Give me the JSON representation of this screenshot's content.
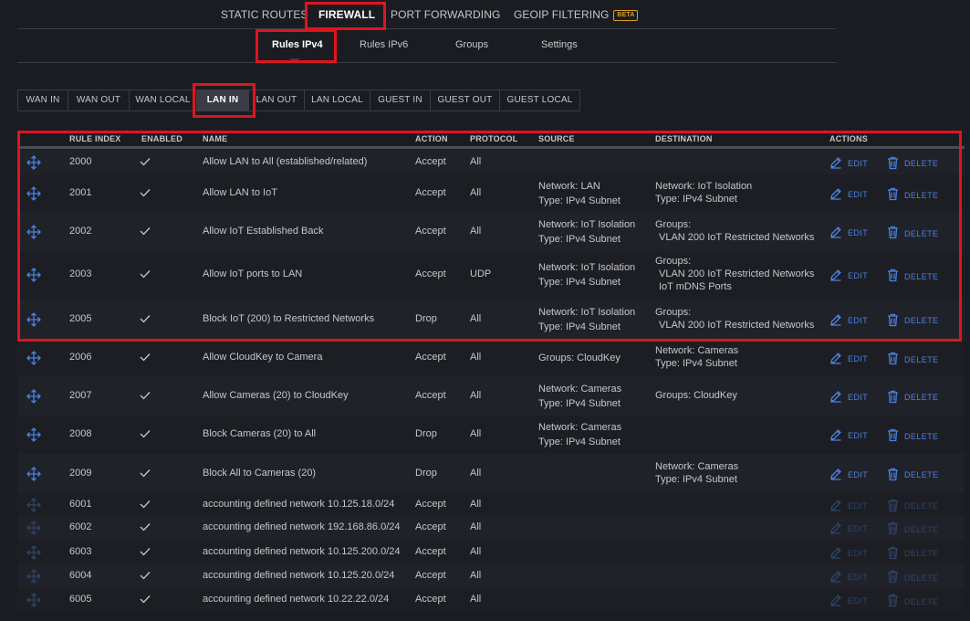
{
  "top_tabs": {
    "static_routes": "STATIC ROUTES",
    "firewall": "FIREWALL",
    "port_forwarding": "PORT FORWARDING",
    "geoip": "GEOIP FILTERING",
    "beta": "BETA"
  },
  "sub_tabs": {
    "rules_ipv4": "Rules IPv4",
    "rules_ipv6": "Rules IPv6",
    "groups": "Groups",
    "settings": "Settings"
  },
  "rule_sets": [
    "WAN IN",
    "WAN OUT",
    "WAN LOCAL",
    "LAN IN",
    "LAN OUT",
    "LAN LOCAL",
    "GUEST IN",
    "GUEST OUT",
    "GUEST LOCAL"
  ],
  "selected_rule_set": "LAN IN",
  "table": {
    "headers": {
      "index": "RULE INDEX",
      "enabled": "ENABLED",
      "name": "NAME",
      "action": "ACTION",
      "protocol": "PROTOCOL",
      "source": "SOURCE",
      "destination": "DESTINATION",
      "actions": "ACTIONS"
    },
    "edit_label": "EDIT",
    "delete_label": "DELETE",
    "rows": [
      {
        "index": "2000",
        "name": "Allow LAN to All (established/related)",
        "action": "Accept",
        "protocol": "All",
        "src1": "",
        "src2": "",
        "dst1": "",
        "dst2": "",
        "dst3": ""
      },
      {
        "index": "2001",
        "name": "Allow LAN to IoT",
        "action": "Accept",
        "protocol": "All",
        "src1": "Network: LAN",
        "src2": "Type: IPv4 Subnet",
        "dst1": "Network: IoT Isolation",
        "dst2": "Type: IPv4 Subnet",
        "dst3": ""
      },
      {
        "index": "2002",
        "name": "Allow IoT Established Back",
        "action": "Accept",
        "protocol": "All",
        "src1": "Network: IoT Isolation",
        "src2": "Type: IPv4 Subnet",
        "dst1": "Groups:",
        "dst2": "VLAN 200 IoT Restricted Networks",
        "dst3": ""
      },
      {
        "index": "2003",
        "name": "Allow IoT ports to LAN",
        "action": "Accept",
        "protocol": "UDP",
        "src1": "Network: IoT Isolation",
        "src2": "Type: IPv4 Subnet",
        "dst1": "Groups:",
        "dst2": "VLAN 200 IoT Restricted Networks",
        "dst3": "IoT mDNS Ports"
      },
      {
        "index": "2005",
        "name": "Block IoT (200) to Restricted Networks",
        "action": "Drop",
        "protocol": "All",
        "src1": "Network: IoT Isolation",
        "src2": "Type: IPv4 Subnet",
        "dst1": "Groups:",
        "dst2": "VLAN 200 IoT Restricted Networks",
        "dst3": ""
      },
      {
        "index": "2006",
        "name": "Allow CloudKey to Camera",
        "action": "Accept",
        "protocol": "All",
        "src1": "Groups:  CloudKey",
        "src2": "",
        "dst1": "Network: Cameras",
        "dst2": "Type: IPv4 Subnet",
        "dst3": ""
      },
      {
        "index": "2007",
        "name": "Allow Cameras (20) to CloudKey",
        "action": "Accept",
        "protocol": "All",
        "src1": "Network: Cameras",
        "src2": "Type: IPv4 Subnet",
        "dst1": "Groups:  CloudKey",
        "dst2": "",
        "dst3": ""
      },
      {
        "index": "2008",
        "name": "Block Cameras (20) to All",
        "action": "Drop",
        "protocol": "All",
        "src1": "Network: Cameras",
        "src2": "Type: IPv4 Subnet",
        "dst1": "",
        "dst2": "",
        "dst3": ""
      },
      {
        "index": "2009",
        "name": "Block All to Cameras (20)",
        "action": "Drop",
        "protocol": "All",
        "src1": "",
        "src2": "",
        "dst1": "Network: Cameras",
        "dst2": "Type: IPv4 Subnet",
        "dst3": ""
      },
      {
        "index": "6001",
        "name": "accounting defined network 10.125.18.0/24",
        "action": "Accept",
        "protocol": "All",
        "src1": "",
        "src2": "",
        "dst1": "",
        "dst2": "",
        "dst3": ""
      },
      {
        "index": "6002",
        "name": "accounting defined network 192.168.86.0/24",
        "action": "Accept",
        "protocol": "All",
        "src1": "",
        "src2": "",
        "dst1": "",
        "dst2": "",
        "dst3": ""
      },
      {
        "index": "6003",
        "name": "accounting defined network 10.125.200.0/24",
        "action": "Accept",
        "protocol": "All",
        "src1": "",
        "src2": "",
        "dst1": "",
        "dst2": "",
        "dst3": ""
      },
      {
        "index": "6004",
        "name": "accounting defined network 10.125.20.0/24",
        "action": "Accept",
        "protocol": "All",
        "src1": "",
        "src2": "",
        "dst1": "",
        "dst2": "",
        "dst3": ""
      },
      {
        "index": "6005",
        "name": "accounting defined network 10.22.22.0/24",
        "action": "Accept",
        "protocol": "All",
        "src1": "",
        "src2": "",
        "dst1": "",
        "dst2": "",
        "dst3": ""
      }
    ]
  },
  "colors": {
    "background": "#1a1c22",
    "accent": "#4b82e0",
    "highlight": "#e0141e",
    "beta": "#d9a12b"
  },
  "icons": {
    "move": "move-arrows-icon",
    "enabled": "check-icon",
    "edit": "pencil-icon",
    "delete": "trash-icon"
  }
}
